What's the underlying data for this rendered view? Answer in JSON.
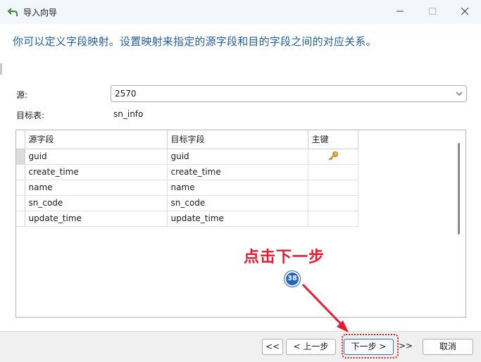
{
  "window": {
    "title": "导入向导"
  },
  "heading": "你可以定义字段映射。设置映射来指定的源字段和目的字段之间的对应关系。",
  "source": {
    "label": "源:",
    "value": "2570"
  },
  "target": {
    "label": "目标表:",
    "value": "sn_info"
  },
  "grid": {
    "columns": [
      "源字段",
      "目标字段",
      "主键"
    ],
    "rows": [
      {
        "source": "guid",
        "target": "guid",
        "primary_key": true
      },
      {
        "source": "create_time",
        "target": "create_time",
        "primary_key": false
      },
      {
        "source": "name",
        "target": "name",
        "primary_key": false
      },
      {
        "source": "sn_code",
        "target": "sn_code",
        "primary_key": false
      },
      {
        "source": "update_time",
        "target": "update_time",
        "primary_key": false
      }
    ]
  },
  "buttons": {
    "first": "<<",
    "prev": "< 上一步",
    "next": "下一步 >",
    "last": ">>",
    "cancel": "取消"
  },
  "annotation": {
    "text": "点击下一步",
    "step": "38"
  },
  "colors": {
    "heading": "#1f5fa8",
    "annotation": "#e8192c",
    "badge": "#1f63c4",
    "key_icon": "#e0a020"
  }
}
